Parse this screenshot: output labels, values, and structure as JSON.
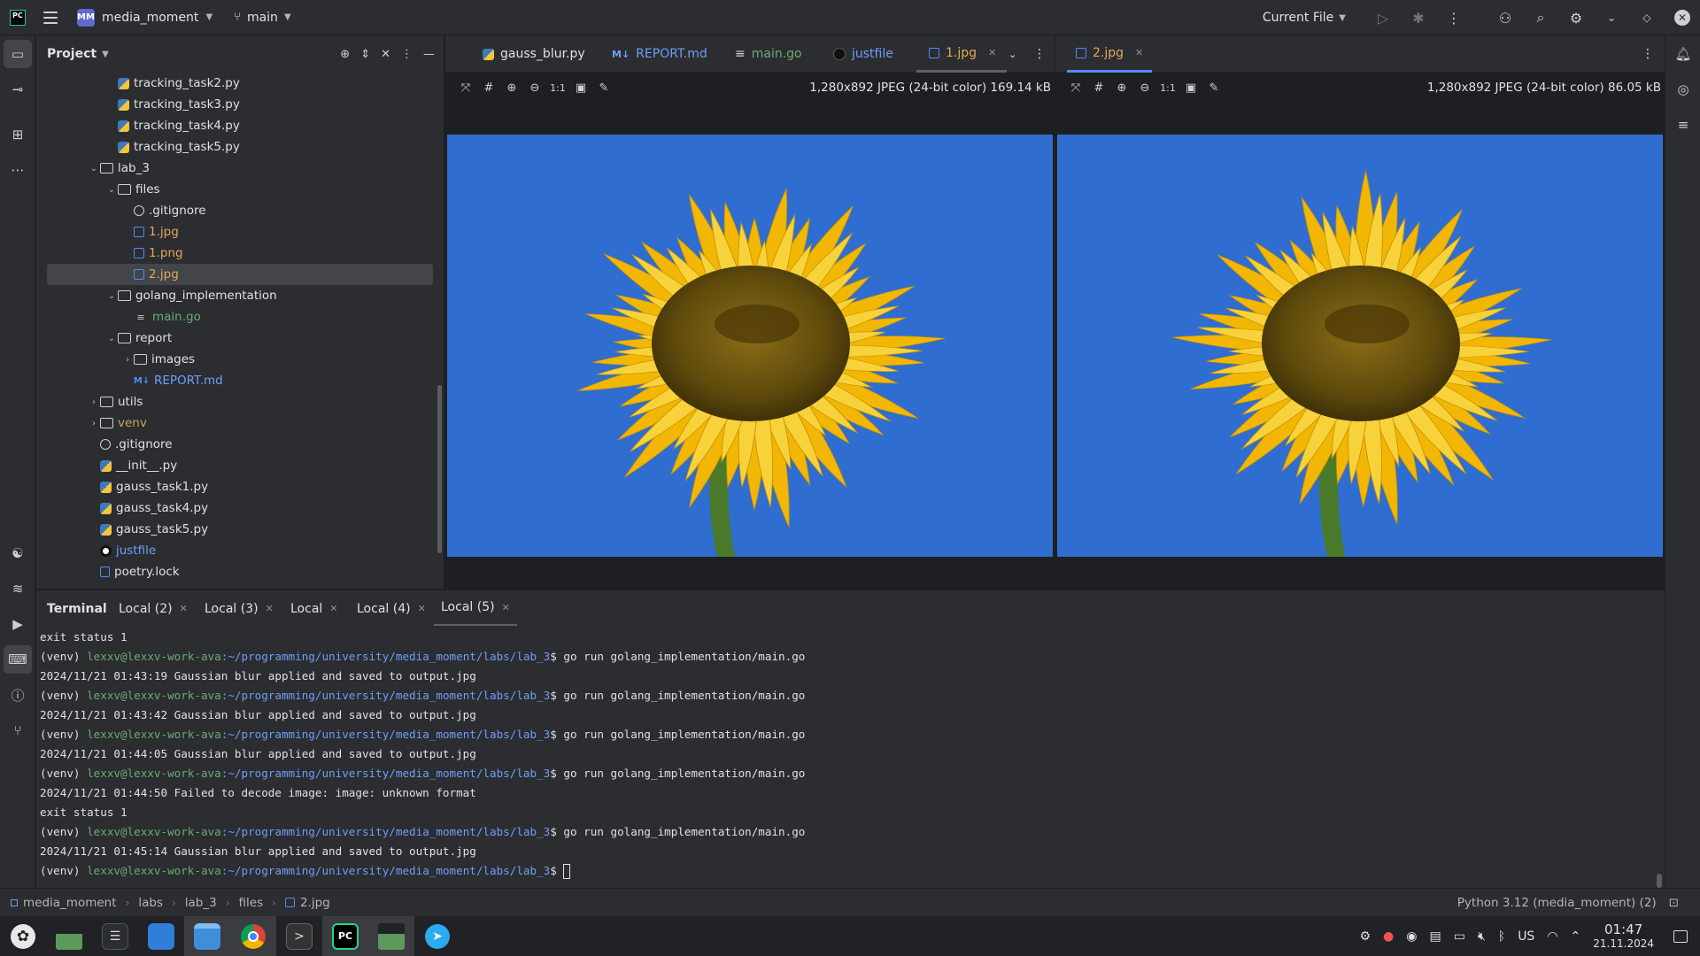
{
  "titlebar": {
    "project_badge": "MM",
    "project_name": "media_moment",
    "branch": "main",
    "run_config": "Current File"
  },
  "project_panel": {
    "title": "Project",
    "tree": [
      {
        "label": "tracking_task2.py",
        "type": "py",
        "depth": 3
      },
      {
        "label": "tracking_task3.py",
        "type": "py",
        "depth": 3
      },
      {
        "label": "tracking_task4.py",
        "type": "py",
        "depth": 3
      },
      {
        "label": "tracking_task5.py",
        "type": "py",
        "depth": 3
      },
      {
        "label": "lab_3",
        "type": "folder",
        "depth": 2,
        "expanded": true
      },
      {
        "label": "files",
        "type": "folder",
        "depth": 3,
        "expanded": true
      },
      {
        "label": ".gitignore",
        "type": "ignore",
        "depth": 4
      },
      {
        "label": "1.jpg",
        "type": "img",
        "depth": 4,
        "color": "orange"
      },
      {
        "label": "1.png",
        "type": "img",
        "depth": 4,
        "color": "orange"
      },
      {
        "label": "2.jpg",
        "type": "img",
        "depth": 4,
        "color": "orange",
        "selected": true
      },
      {
        "label": "golang_implementation",
        "type": "folder",
        "depth": 3,
        "expanded": true
      },
      {
        "label": "main.go",
        "type": "go",
        "depth": 4,
        "color": "green"
      },
      {
        "label": "report",
        "type": "folder",
        "depth": 3,
        "expanded": true
      },
      {
        "label": "images",
        "type": "folder",
        "depth": 4,
        "collapsed": true
      },
      {
        "label": "REPORT.md",
        "type": "md",
        "depth": 4,
        "color": "blue"
      },
      {
        "label": "utils",
        "type": "folder",
        "depth": 2,
        "collapsed": true
      },
      {
        "label": "venv",
        "type": "folder",
        "depth": 2,
        "collapsed": true,
        "color": "olive"
      },
      {
        "label": ".gitignore",
        "type": "ignore",
        "depth": 2
      },
      {
        "label": "__init__.py",
        "type": "py",
        "depth": 2
      },
      {
        "label": "gauss_task1.py",
        "type": "py",
        "depth": 2
      },
      {
        "label": "gauss_task4.py",
        "type": "py",
        "depth": 2
      },
      {
        "label": "gauss_task5.py",
        "type": "py",
        "depth": 2
      },
      {
        "label": "justfile",
        "type": "just",
        "depth": 2,
        "color": "blue"
      },
      {
        "label": "poetry.lock",
        "type": "lock",
        "depth": 2
      }
    ]
  },
  "editor_tabs": {
    "left": [
      {
        "label": "gauss_blur.py",
        "icon": "python-icon"
      },
      {
        "label": "REPORT.md",
        "icon": "markdown-icon",
        "color": "#6f9ef8"
      },
      {
        "label": "main.go",
        "icon": "go-file-icon",
        "color": "#6aab73"
      },
      {
        "label": "justfile",
        "icon": "justfile-icon",
        "color": "#6f9ef8"
      },
      {
        "label": "1.jpg",
        "icon": "image-file-icon",
        "color": "#e2a85a",
        "active": true
      }
    ],
    "right": [
      {
        "label": "2.jpg",
        "icon": "image-file-icon",
        "color": "#e2a85a",
        "active": true
      }
    ]
  },
  "image_left": {
    "zoom_label": "1:1",
    "info": "1,280x892 JPEG (24-bit color) 169.14 kB"
  },
  "image_right": {
    "zoom_label": "1:1",
    "info": "1,280x892 JPEG (24-bit color) 86.05 kB"
  },
  "terminal": {
    "title": "Terminal",
    "tabs": [
      "Local (2)",
      "Local (3)",
      "Local",
      "Local (4)",
      "Local (5)"
    ],
    "active_tab": "Local (5)",
    "prompt_prefix": "(venv) ",
    "prompt_user": "lexxv@lexxv-work-ava",
    "prompt_path": ":~/programming/university/media_moment/labs/lab_3",
    "lines": [
      {
        "kind": "out",
        "text": "exit status 1"
      },
      {
        "kind": "cmd",
        "text": "$ go run golang_implementation/main.go"
      },
      {
        "kind": "out",
        "text": "2024/11/21 01:43:19 Gaussian blur applied and saved to output.jpg"
      },
      {
        "kind": "cmd",
        "text": "$ go run golang_implementation/main.go"
      },
      {
        "kind": "out",
        "text": "2024/11/21 01:43:42 Gaussian blur applied and saved to output.jpg"
      },
      {
        "kind": "cmd",
        "text": "$ go run golang_implementation/main.go"
      },
      {
        "kind": "out",
        "text": "2024/11/21 01:44:05 Gaussian blur applied and saved to output.jpg"
      },
      {
        "kind": "cmd",
        "text": "$ go run golang_implementation/main.go"
      },
      {
        "kind": "out",
        "text": "2024/11/21 01:44:50 Failed to decode image: image: unknown format"
      },
      {
        "kind": "out",
        "text": "exit status 1"
      },
      {
        "kind": "cmd",
        "text": "$ go run golang_implementation/main.go"
      },
      {
        "kind": "out",
        "text": "2024/11/21 01:45:14 Gaussian blur applied and saved to output.jpg"
      },
      {
        "kind": "cmd",
        "text": "$ "
      }
    ]
  },
  "statusbar": {
    "breadcrumb": [
      "media_moment",
      "labs",
      "lab_3",
      "files",
      "2.jpg"
    ],
    "interpreter": "Python 3.12 (media_moment) (2)"
  },
  "taskbar": {
    "keyboard_layout": "US",
    "time": "01:47",
    "date": "21.11.2024"
  },
  "colors": {
    "accent": "#548af7",
    "background": "#1e1f22",
    "panel": "#2b2d30",
    "sky": "#2f6ed0",
    "petal": "#f5c518",
    "seed_center": "#6b5410",
    "terminal_user": "#6aab73",
    "terminal_path": "#6f9ef8"
  }
}
